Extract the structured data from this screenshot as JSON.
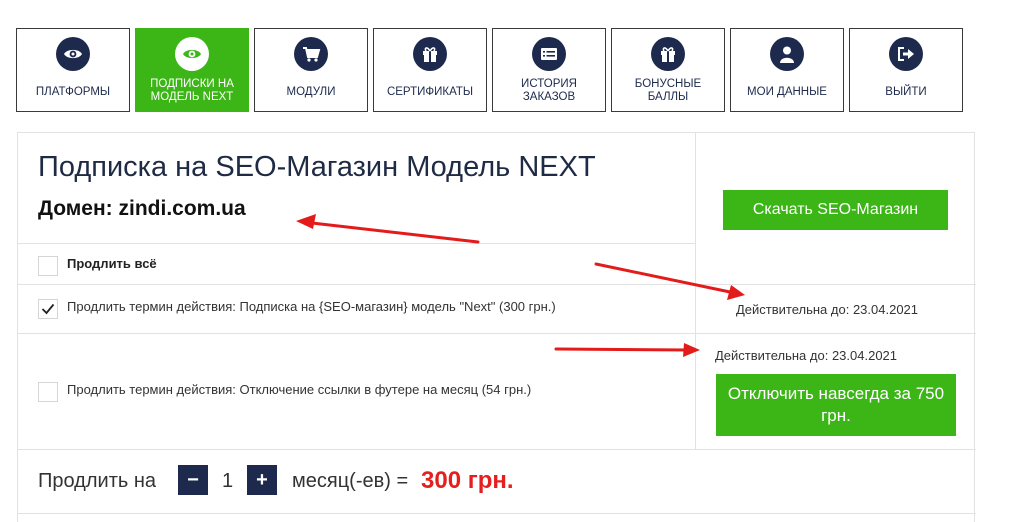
{
  "nav": [
    {
      "label": "ПЛАТФОРМЫ",
      "icon": "eye-icon"
    },
    {
      "label": "ПОДПИСКИ НА МОДЕЛЬ NEXT",
      "icon": "eye-icon"
    },
    {
      "label": "МОДУЛИ",
      "icon": "cart-icon"
    },
    {
      "label": "СЕРТИФИКАТЫ",
      "icon": "gift-icon"
    },
    {
      "label": "ИСТОРИЯ ЗАКАЗОВ",
      "icon": "list-icon"
    },
    {
      "label": "БОНУСНЫЕ БАЛЛЫ",
      "icon": "gift-icon"
    },
    {
      "label": "МОИ ДАННЫЕ",
      "icon": "user-icon"
    },
    {
      "label": "ВЫЙТИ",
      "icon": "logout-icon"
    }
  ],
  "subscription": {
    "title": "Подписка на SEO-Магазин Модель NEXT",
    "domain": "Домен: zindi.com.ua",
    "download_label": "Скачать SEO-Магазин",
    "renew_all_label": "Продлить всё",
    "items": [
      {
        "label": "Продлить термин действия: Подписка на {SEO-магазин} модель \"Next\" (300 грн.)",
        "checked": true,
        "valid_until": "Действительна до: 23.04.2021"
      },
      {
        "label": "Продлить термин действия: Отключение ссылки в футере на месяц (54 грн.)",
        "checked": false,
        "valid_until": "Действительна до: 23.04.2021",
        "action_label": "Отключить навсегда за 750 грн."
      }
    ],
    "extend_label": "Продлить на",
    "minus": "−",
    "plus": "+",
    "months": "1",
    "unit_label": "месяц(-ев) =",
    "total": "300 грн."
  },
  "colors": {
    "accent": "#3cb516",
    "navy": "#1d2a4d",
    "price": "#e51e1e",
    "annotation": "#e31b1b"
  }
}
